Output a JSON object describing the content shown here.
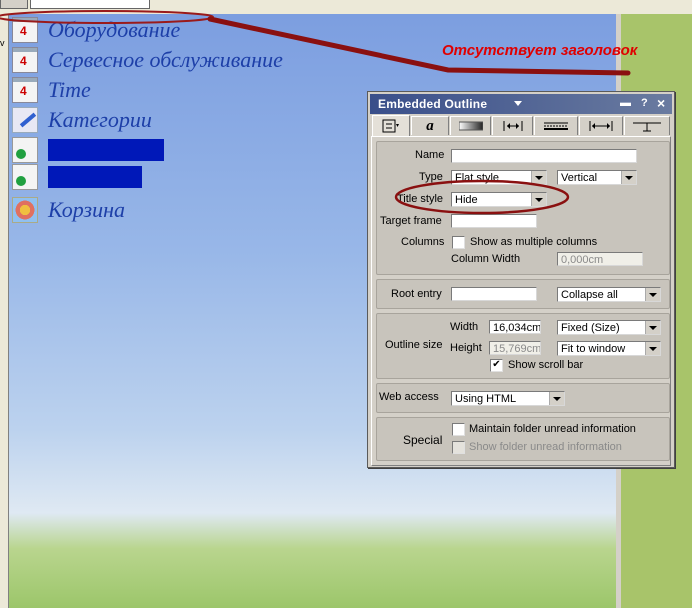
{
  "nav": {
    "items": [
      {
        "label": "Оборудование",
        "icon": "calendar-icon"
      },
      {
        "label": "Сервесное обслуживание",
        "icon": "calendar-icon"
      },
      {
        "label": "Time",
        "icon": "calendar-icon"
      },
      {
        "label": "Категории",
        "icon": "pen-icon"
      },
      {
        "label": "",
        "icon": "document-icon",
        "redacted": true
      },
      {
        "label": "",
        "icon": "document-icon",
        "redacted": true
      },
      {
        "label": "Корзина",
        "icon": "basket-icon"
      }
    ]
  },
  "annotation": {
    "text": "Отсутствует заголовок",
    "color": "#e00000"
  },
  "dialog": {
    "title": "Embedded Outline",
    "buttons": {
      "menu": "▬",
      "help": "?",
      "close": "×"
    },
    "tabs": [
      "info-icon",
      "font-a",
      "color-bar-icon",
      "spacing-icon",
      "border-icon",
      "width-icon",
      "hide-when-icon"
    ],
    "tab_a_label": "a",
    "group1": {
      "name_label": "Name",
      "name_value": "",
      "type_label": "Type",
      "type_value": "Flat style",
      "orientation_value": "Vertical",
      "title_style_label": "Title style",
      "title_style_value": "Hide",
      "target_frame_label": "Target frame",
      "target_frame_value": "",
      "columns_label": "Columns",
      "show_multiple_label": "Show as multiple columns",
      "column_width_label": "Column Width",
      "column_width_value": "0,000cm"
    },
    "group2": {
      "root_entry_label": "Root entry",
      "root_entry_value": "",
      "collapse_value": "Collapse all"
    },
    "group3": {
      "outline_size_label": "Outline size",
      "width_label": "Width",
      "width_value": "16,034cm",
      "width_mode": "Fixed (Size)",
      "height_label": "Height",
      "height_value": "15,769cm",
      "height_mode": "Fit to window",
      "scroll_label": "Show scroll bar",
      "scroll_checked": "✔"
    },
    "group4": {
      "web_access_label": "Web access",
      "web_access_value": "Using HTML"
    },
    "group5": {
      "special_label": "Special",
      "maintain_label": "Maintain folder unread information",
      "show_unread_label": "Show folder unread information"
    }
  }
}
